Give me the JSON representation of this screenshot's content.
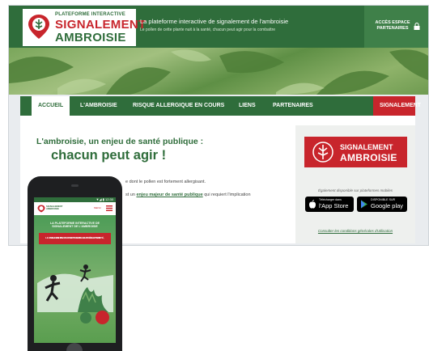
{
  "header": {
    "logo_line1": "PLATEFORME INTERACTIVE",
    "logo_line2": "SIGNALEMENT",
    "logo_line3": "AMBROISIE",
    "tagline": "La plateforme interactive de signalement de l'ambroisie",
    "subtagline": "Le pollen de cette plante nuit à la santé, chacun peut agir pour la combattre",
    "espace_line1": "ACCÈS ESPACE",
    "espace_line2": "PARTENAIRES"
  },
  "nav": {
    "items": [
      "ACCUEIL",
      "L'AMBROISIE",
      "RISQUE ALLERGIQUE EN COURS",
      "LIENS",
      "PARTENAIRES"
    ],
    "signalement": "SIGNALEMENT"
  },
  "content": {
    "title_line1": "L'ambroisie, un enjeu de santé publique :",
    "title_line2": "chacun peut agir !",
    "text1": "e dont le pollen est fortement allergisant.",
    "text2_pre": "st un ",
    "text2_link": "enjeu majeur de santé publique",
    "text2_post": " qui requiert l'implication"
  },
  "panel": {
    "sig_line1": "SIGNALEMENT",
    "sig_line2": "AMBROISIE",
    "disponible": "Également disponible sur plateformes mobiles",
    "appstore_small": "Télécharger dans",
    "appstore_big": "l'App Store",
    "gplay_small": "DISPONIBLE SUR",
    "gplay_big": "Google play",
    "conditions": "Consulter les conditions générales d'utilisation"
  },
  "phone": {
    "status": "▼◢ ▮ 12:30",
    "logo_line1": "SIGNALEMENT",
    "logo_line2": "AMBROISIE",
    "menu_label": "MENU",
    "hero_line1": "LA PLATEFORME INTERACTIVE DE",
    "hero_line2": "SIGNALEMENT DE L'AMBROISIE",
    "red_line1": "LE POLLEN DE CETTE PLANTE NUIT À LA SANTÉ,",
    "red_line2": "CHACUN PEUT AGIR POUR LA COMBATTRE"
  },
  "colors": {
    "green": "#2f6d3b",
    "red": "#c8252c"
  }
}
